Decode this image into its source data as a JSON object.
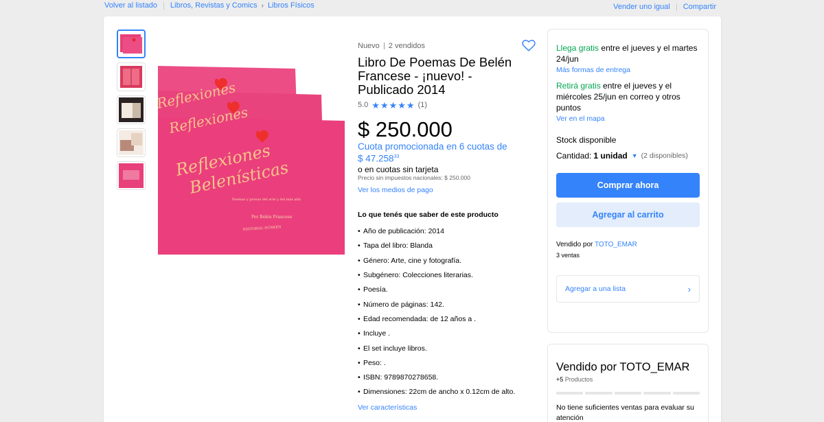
{
  "nav": {
    "back": "Volver al listado",
    "category": "Libros, Revistas y Comics",
    "subcategory": "Libros Físicos",
    "sell_same": "Vender uno igual",
    "share": "Compartir"
  },
  "product": {
    "condition": "Nuevo",
    "sold": "2 vendidos",
    "title": "Libro De Poemas De Belén Francese - ¡nuevo! - Publicado 2014",
    "rating": "5.0",
    "rating_value": 5,
    "rating_count": "(1)",
    "price": "$ 250.000",
    "promo_prefix": "Cuota promocionada en 6 cuotas de",
    "promo_amount": "$ 47.258",
    "promo_cents": "33",
    "no_card": "o en cuotas sin tarjeta",
    "taxes": "Precio sin impuestos nacionales: $ 250.000",
    "payment_link": "Ver los medios de pago",
    "features_title": "Lo que tenés que saber de este producto",
    "features": [
      "Año de publicación: 2014",
      "Tapa del libro: Blanda",
      "Género: Arte, cine y fotografía.",
      "Subgénero: Colecciones literarias.",
      "Poesía.",
      "Número de páginas: 142.",
      "Edad recomendada: de 12 años a .",
      "Incluye .",
      "El set incluye libros.",
      "Peso: .",
      "ISBN: 9789870278658.",
      "Dimensiones: 22cm de ancho x 0.12cm de alto."
    ],
    "features_link": "Ver características",
    "book_cover_text": [
      "Reflexiones",
      "Belenísticas",
      "Poemas y prosas del arte y del más allá",
      "Por Belén Francese",
      "EDITORIAL DUNKEN"
    ]
  },
  "buybox": {
    "ship_label": "Llega gratis",
    "ship_text": "entre el jueves y el martes 24/jun",
    "more_delivery": "Más formas de entrega",
    "pickup_label": "Retirá gratis",
    "pickup_text": "entre el jueves y el miércoles 25/jun en correo y otros puntos",
    "map_link": "Ver en el mapa",
    "stock": "Stock disponible",
    "qty_label": "Cantidad:",
    "qty_value": "1 unidad",
    "qty_available": "(2 disponibles)",
    "buy_now": "Comprar ahora",
    "add_cart": "Agregar al carrito",
    "sold_by": "Vendido por",
    "seller": "TOTO_EMAR",
    "sales": "3 ventas",
    "add_list": "Agregar a una lista"
  },
  "seller_box": {
    "title": "Vendido por TOTO_EMAR",
    "products_count": "+5",
    "products_label": "Productos",
    "note": "No tiene suficientes ventas para evaluar su atención"
  },
  "colors": {
    "accent": "#3483fa",
    "green": "#00a650",
    "book_pink": "#e8407a"
  }
}
